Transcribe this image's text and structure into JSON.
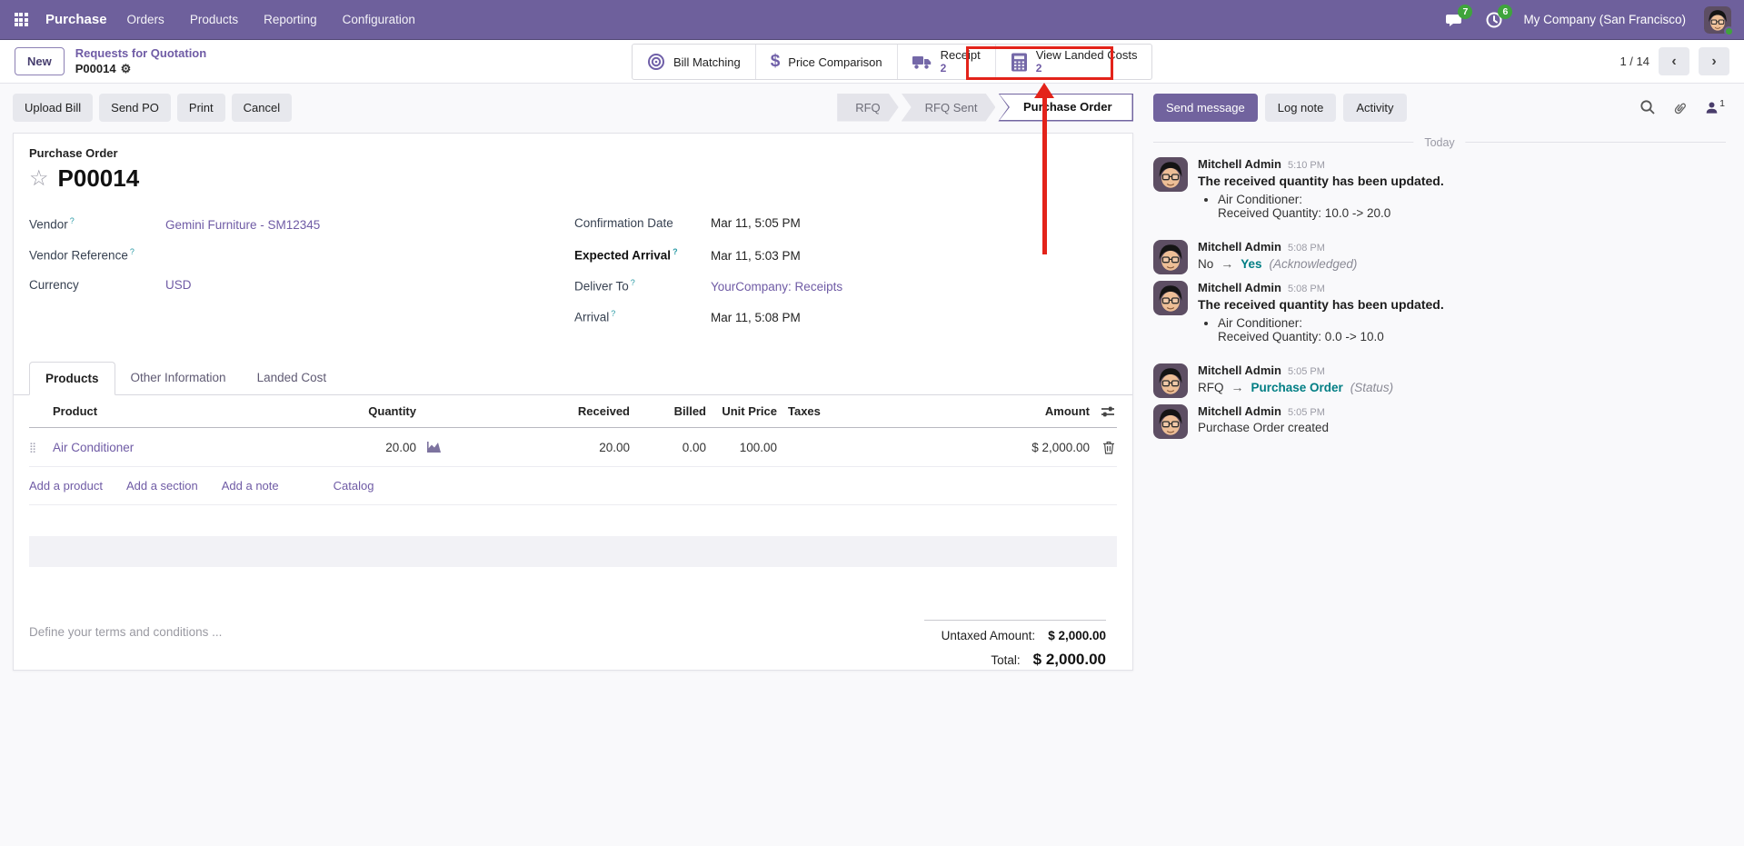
{
  "navbar": {
    "app_name": "Purchase",
    "menus": [
      "Orders",
      "Products",
      "Reporting",
      "Configuration"
    ],
    "messages_badge": "7",
    "activities_badge": "6",
    "company": "My Company (San Francisco)"
  },
  "control_panel": {
    "new_label": "New",
    "breadcrumb_parent": "Requests for Quotation",
    "breadcrumb_current": "P00014",
    "pager": "1 / 14",
    "smart_buttons": [
      {
        "label": "Bill Matching",
        "count": ""
      },
      {
        "label": "Price Comparison",
        "count": ""
      },
      {
        "label": "Receipt",
        "count": "2"
      },
      {
        "label": "View Landed Costs",
        "count": "2"
      }
    ]
  },
  "actions": [
    "Upload Bill",
    "Send PO",
    "Print",
    "Cancel"
  ],
  "statusbar": {
    "steps": [
      "RFQ",
      "RFQ Sent",
      "Purchase Order"
    ]
  },
  "form": {
    "doc_type": "Purchase Order",
    "name": "P00014",
    "fields_left": [
      {
        "label": "Vendor",
        "value": "Gemini Furniture - SM12345"
      },
      {
        "label": "Vendor Reference",
        "value": ""
      },
      {
        "label": "Currency",
        "value": "USD"
      }
    ],
    "fields_right": [
      {
        "label": "Confirmation Date",
        "value": "Mar 11, 5:05 PM"
      },
      {
        "label": "Expected Arrival",
        "value": "Mar 11, 5:03 PM"
      },
      {
        "label": "Deliver To",
        "value": "YourCompany: Receipts"
      },
      {
        "label": "Arrival",
        "value": "Mar 11, 5:08 PM"
      }
    ],
    "tabs": [
      "Products",
      "Other Information",
      "Landed Cost"
    ],
    "table": {
      "headers": [
        "Product",
        "Quantity",
        "Received",
        "Billed",
        "Unit Price",
        "Taxes",
        "Amount"
      ],
      "rows": [
        {
          "product": "Air Conditioner",
          "quantity": "20.00",
          "received": "20.00",
          "billed": "0.00",
          "unit_price": "100.00",
          "taxes": "",
          "amount": "$ 2,000.00"
        }
      ],
      "add_links": [
        "Add a product",
        "Add a section",
        "Add a note"
      ],
      "catalog_link": "Catalog"
    },
    "terms_placeholder": "Define your terms and conditions ...",
    "totals": {
      "untaxed_label": "Untaxed Amount:",
      "untaxed_value": "$ 2,000.00",
      "total_label": "Total:",
      "total_value": "$ 2,000.00"
    }
  },
  "chatter": {
    "buttons": [
      "Send message",
      "Log note",
      "Activity"
    ],
    "followers_count": "1",
    "divider": "Today",
    "messages": [
      {
        "author": "Mitchell Admin",
        "time": "5:10 PM",
        "title": "The received quantity has been updated.",
        "item": "Air Conditioner:",
        "detail": "Received Quantity: 10.0 -> 20.0"
      },
      {
        "author": "Mitchell Admin",
        "time": "5:08 PM",
        "from": "No",
        "to": "Yes",
        "note": "(Acknowledged)"
      },
      {
        "author": "Mitchell Admin",
        "time": "5:08 PM",
        "title": "The received quantity has been updated.",
        "item": "Air Conditioner:",
        "detail": "Received Quantity: 0.0 -> 10.0"
      },
      {
        "author": "Mitchell Admin",
        "time": "5:05 PM",
        "from": "RFQ",
        "to": "Purchase Order",
        "note": "(Status)"
      },
      {
        "author": "Mitchell Admin",
        "time": "5:05 PM",
        "body": "Purchase Order created"
      }
    ]
  },
  "colors": {
    "navbar": "#6e609c",
    "accent": "#6f5ba5",
    "annotation_red": "#e3231a",
    "tracking_teal": "#017e84",
    "badge_green": "#3fa43c"
  }
}
